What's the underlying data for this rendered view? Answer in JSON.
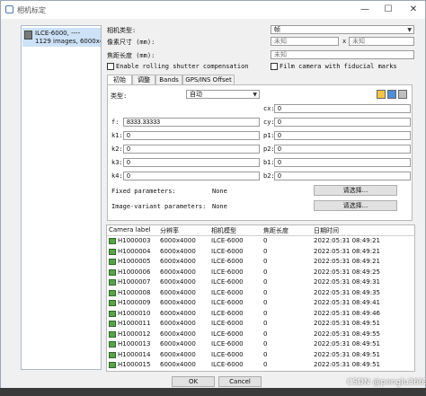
{
  "window": {
    "title": "相机标定",
    "min_glyph": "—",
    "max_glyph": "☐",
    "close_glyph": "✕"
  },
  "sidebar": {
    "camera_name": "ILCE-6000, ----",
    "camera_info": "1129 images, 6000x4000"
  },
  "form": {
    "camera_type_label": "相机类型:",
    "camera_type_value": "帧",
    "pixel_size_label": "像素尺寸 (mm):",
    "pixel_w_placeholder": "未知",
    "pixel_x_sep": "x",
    "pixel_h_placeholder": "未知",
    "focal_label": "焦距长度 (mm):",
    "focal_placeholder": "未知",
    "rolling_shutter_label": "Enable rolling shutter compensation",
    "film_camera_label": "Film camera with fiducial marks"
  },
  "tabs": [
    "初始",
    "调整",
    "Bands",
    "GPS/INS Offset"
  ],
  "panel": {
    "type_label": "类型:",
    "type_value": "自动",
    "f_label": "f:",
    "f_value": "8333.33333",
    "cx_label": "cx:",
    "cx_value": "0",
    "cy_label": "cy:",
    "cy_value": "0",
    "k1_label": "k1:",
    "k1_value": "0",
    "k2_label": "k2:",
    "k2_value": "0",
    "k3_label": "k3:",
    "k3_value": "0",
    "k4_label": "k4:",
    "k4_value": "0",
    "p1_label": "p1:",
    "p1_value": "0",
    "p2_label": "p2:",
    "p2_value": "0",
    "b1_label": "b1:",
    "b1_value": "0",
    "b2_label": "b2:",
    "b2_value": "0",
    "fixed_label": "Fixed parameters:",
    "fixed_value": "None",
    "fixed_button": "请选择...",
    "variant_label": "Image-variant parameters:",
    "variant_value": "None",
    "variant_button": "请选择..."
  },
  "table": {
    "headers": [
      "Camera label",
      "分辨率",
      "相机模型",
      "焦距长度",
      "日期时间"
    ],
    "rows": [
      [
        "H1000003",
        "6000x4000",
        "ILCE-6000",
        "0",
        "2022:05:31 08:49:21"
      ],
      [
        "H1000004",
        "6000x4000",
        "ILCE-6000",
        "0",
        "2022:05:31 08:49:21"
      ],
      [
        "H1000005",
        "6000x4000",
        "ILCE-6000",
        "0",
        "2022:05:31 08:49:21"
      ],
      [
        "H1000006",
        "6000x4000",
        "ILCE-6000",
        "0",
        "2022:05:31 08:49:25"
      ],
      [
        "H1000007",
        "6000x4000",
        "ILCE-6000",
        "0",
        "2022:05:31 08:49:31"
      ],
      [
        "H1000008",
        "6000x4000",
        "ILCE-6000",
        "0",
        "2022:05:31 08:49:35"
      ],
      [
        "H1000009",
        "6000x4000",
        "ILCE-6000",
        "0",
        "2022:05:31 08:49:41"
      ],
      [
        "H1000010",
        "6000x4000",
        "ILCE-6000",
        "0",
        "2022:05:31 08:49:46"
      ],
      [
        "H1000011",
        "6000x4000",
        "ILCE-6000",
        "0",
        "2022:05:31 08:49:51"
      ],
      [
        "H1000012",
        "6000x4000",
        "ILCE-6000",
        "0",
        "2022:05:31 08:49:55"
      ],
      [
        "H1000013",
        "6000x4000",
        "ILCE-6000",
        "0",
        "2022:05:31 08:49:51"
      ],
      [
        "H1000014",
        "6000x4000",
        "ILCE-6000",
        "0",
        "2022:05:31 08:49:51"
      ],
      [
        "H1000015",
        "6000x4000",
        "ILCE-6000",
        "0",
        "2022:05:31 08:49:51"
      ]
    ]
  },
  "buttons": {
    "ok": "OK",
    "cancel": "Cancel"
  },
  "watermark": "CSDN @penglu366366",
  "colors": {
    "selection": "#cde2f7",
    "row_icon": "#5aa24a"
  }
}
